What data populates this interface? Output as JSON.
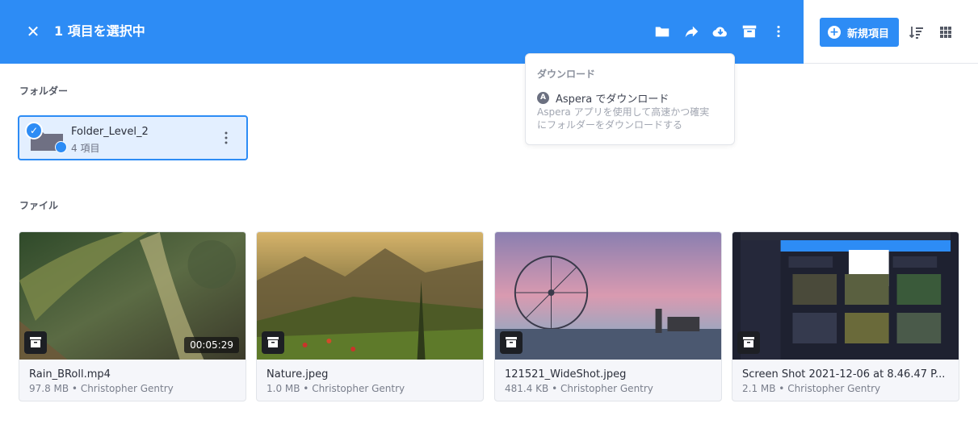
{
  "selection": {
    "close_label": "✕",
    "title": "1 項目を選択中"
  },
  "toolbar_icons": [
    "folder-icon",
    "share-icon",
    "cloud-download-icon",
    "archive-icon",
    "more-vertical-icon"
  ],
  "new_item": {
    "label": "新規項目"
  },
  "download_menu": {
    "heading": "ダウンロード",
    "item_label": "Aspera でダウンロード",
    "item_desc": "Aspera アプリを使用して高速かつ確実にフォルダーをダウンロードする"
  },
  "sections": {
    "folders": "フォルダー",
    "files": "ファイル"
  },
  "folders": [
    {
      "name": "Folder_Level_2",
      "count": "4 項目",
      "selected": true
    }
  ],
  "files": [
    {
      "name": "Rain_BRoll.mp4",
      "meta": "97.8 MB • Christopher Gentry",
      "duration": "00:05:29"
    },
    {
      "name": "Nature.jpeg",
      "meta": "1.0 MB • Christopher Gentry"
    },
    {
      "name": "121521_WideShot.jpeg",
      "meta": "481.4 KB • Christopher Gentry"
    },
    {
      "name": "Screen Shot 2021-12-06 at 8.46.47 P...",
      "meta": "2.1 MB • Christopher Gentry"
    }
  ],
  "colors": {
    "accent": "#2d8cf5",
    "selected_bg": "#e3efff"
  }
}
